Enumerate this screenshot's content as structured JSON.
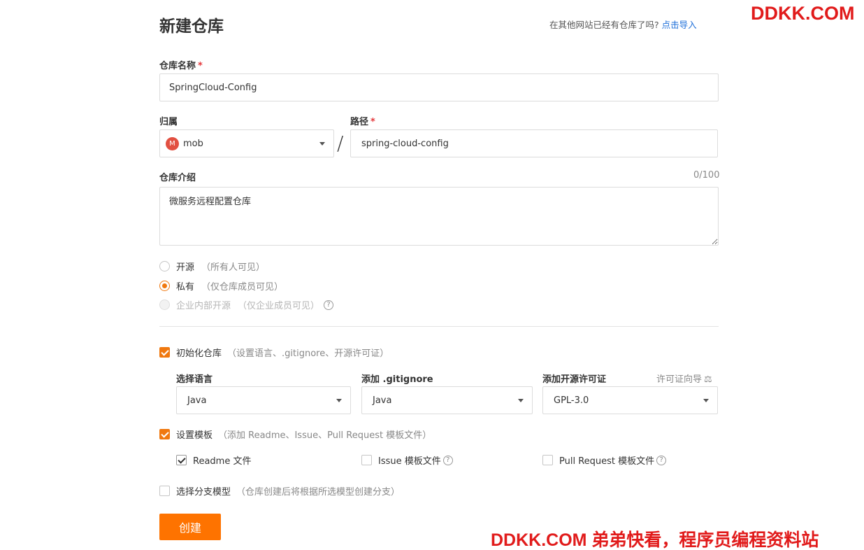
{
  "page": {
    "title": "新建仓库",
    "import_hint": "在其他网站已经有仓库了吗?",
    "import_link": "点击导入"
  },
  "watermark": {
    "top": "DDKK.COM",
    "bottom": "DDKK.COM 弟弟快看，程序员编程资料站"
  },
  "repo_name": {
    "label": "仓库名称",
    "required_mark": "*",
    "value": "SpringCloud-Config"
  },
  "owner": {
    "label": "归属",
    "avatar_letter": "M",
    "value": "mob"
  },
  "separator": "/",
  "path": {
    "label": "路径",
    "required_mark": "*",
    "value": "spring-cloud-config"
  },
  "description": {
    "label": "仓库介绍",
    "counter": "0/100",
    "value": "微服务远程配置仓库"
  },
  "visibility": {
    "options": [
      {
        "label": "开源",
        "hint": "（所有人可见）",
        "state": "unchecked"
      },
      {
        "label": "私有",
        "hint": "（仅仓库成员可见）",
        "state": "checked"
      },
      {
        "label": "企业内部开源",
        "hint": "（仅企业成员可见）",
        "state": "disabled"
      }
    ]
  },
  "init_repo": {
    "label": "初始化仓库",
    "hint": "（设置语言、.gitignore、开源许可证）",
    "checked": true
  },
  "language": {
    "label": "选择语言",
    "value": "Java"
  },
  "gitignore": {
    "label": "添加 .gitignore",
    "value": "Java"
  },
  "license": {
    "label": "添加开源许可证",
    "guide": "许可证向导",
    "guide_icon": "scale-icon",
    "value": "GPL-3.0"
  },
  "template": {
    "label": "设置模板",
    "hint": "（添加 Readme、Issue、Pull Request 模板文件）",
    "checked": true,
    "options": [
      {
        "label": "Readme 文件",
        "checked": true
      },
      {
        "label": "Issue 模板文件",
        "checked": false
      },
      {
        "label": "Pull Request 模板文件",
        "checked": false
      }
    ]
  },
  "branch_model": {
    "label": "选择分支模型",
    "hint": "（仓库创建后将根据所选模型创建分支）",
    "checked": false
  },
  "submit": {
    "label": "创建"
  },
  "colors": {
    "accent": "#f0780f",
    "button": "#fe7300",
    "link": "#1e6fd9",
    "required": "#e4393c",
    "watermark": "#e11b1b"
  }
}
